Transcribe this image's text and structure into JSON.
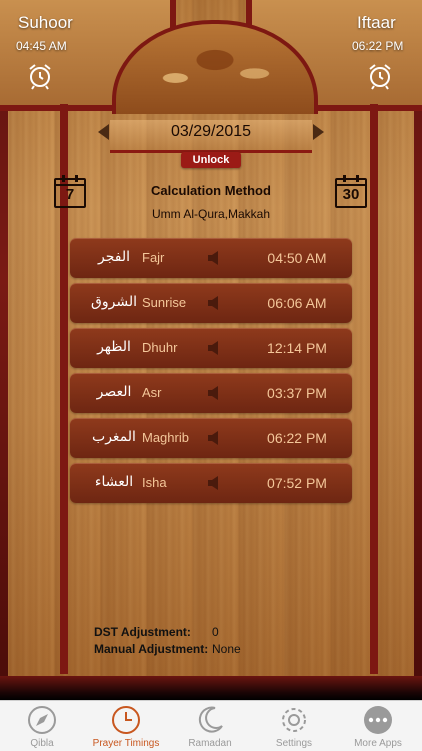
{
  "suhoor": {
    "label": "Suhoor",
    "time": "04:45 AM"
  },
  "iftaar": {
    "label": "Iftaar",
    "time": "06:22 PM"
  },
  "date": {
    "value": "03/29/2015",
    "unlock_label": "Unlock"
  },
  "calendar": {
    "left_day": "7",
    "right_day": "30"
  },
  "calculation": {
    "title": "Calculation Method",
    "value": "Umm Al-Qura,Makkah"
  },
  "prayers": [
    {
      "arabic": "الفجر",
      "name": "Fajr",
      "time": "04:50 AM"
    },
    {
      "arabic": "الشروق",
      "name": "Sunrise",
      "time": "06:06 AM"
    },
    {
      "arabic": "الظهر",
      "name": "Dhuhr",
      "time": "12:14 PM"
    },
    {
      "arabic": "العصر",
      "name": "Asr",
      "time": "03:37 PM"
    },
    {
      "arabic": "المغرب",
      "name": "Maghrib",
      "time": "06:22 PM"
    },
    {
      "arabic": "العشاء",
      "name": "Isha",
      "time": "07:52 PM"
    }
  ],
  "adjustments": {
    "dst_label": "DST Adjustment:",
    "dst_value": "0",
    "manual_label": "Manual Adjustment:",
    "manual_value": "None"
  },
  "tabs": [
    {
      "label": "Qibla",
      "icon": "compass-icon",
      "active": false
    },
    {
      "label": "Prayer Timings",
      "icon": "clock-icon",
      "active": true
    },
    {
      "label": "Ramadan",
      "icon": "crescent-moon-icon",
      "active": false
    },
    {
      "label": "Settings",
      "icon": "gear-icon",
      "active": false
    },
    {
      "label": "More Apps",
      "icon": "more-dots-icon",
      "active": false
    }
  ],
  "colors": {
    "accent": "#c8571f",
    "banner_red": "#7d1812",
    "row_brown": "#8f3a1c",
    "row_text": "#f4c79a"
  }
}
